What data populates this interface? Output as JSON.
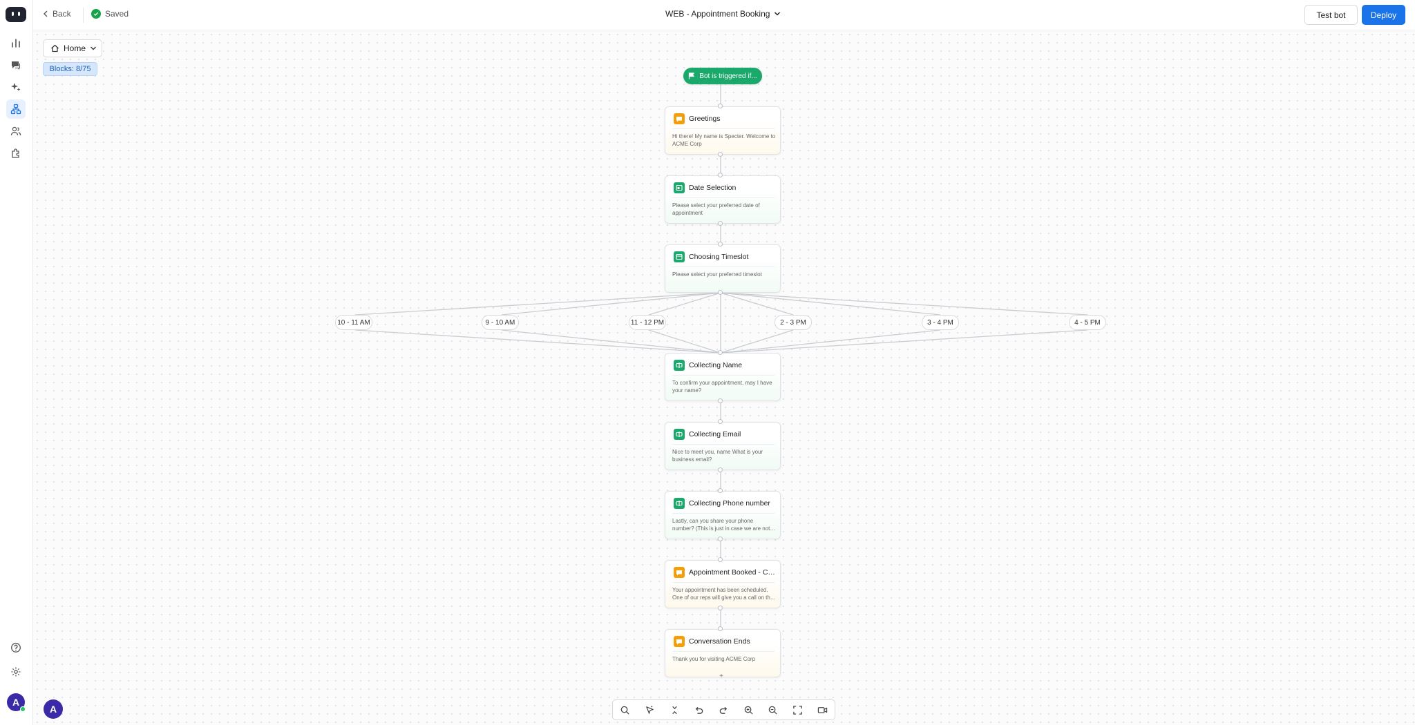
{
  "topbar": {
    "back_label": "Back",
    "saved_label": "Saved",
    "bot_title": "WEB - Appointment Booking",
    "test_bot_label": "Test bot",
    "deploy_label": "Deploy"
  },
  "sidebar": {
    "items": [
      {
        "name": "analytics",
        "icon": "bar-chart-icon"
      },
      {
        "name": "conversations",
        "icon": "chat-icon"
      },
      {
        "name": "ai",
        "icon": "sparkles-icon"
      },
      {
        "name": "builder",
        "icon": "flow-icon",
        "active": true
      },
      {
        "name": "contacts",
        "icon": "users-icon"
      },
      {
        "name": "integrations",
        "icon": "puzzle-icon"
      }
    ],
    "bottom_items": [
      {
        "name": "help",
        "icon": "help-icon"
      },
      {
        "name": "settings",
        "icon": "gear-icon"
      }
    ],
    "avatar_letter": "A"
  },
  "canvas": {
    "home_label": "Home",
    "blocks_label": "Blocks: 8/75",
    "trigger_label": "Bot is triggered if...",
    "workspace_avatar": "A",
    "nodes": [
      {
        "title": "Greetings",
        "text": "Hi there! My name is Specter. Welcome to ACME Corp",
        "kind": "message"
      },
      {
        "title": "Date Selection",
        "text": "Please select your preferred date of appointment",
        "kind": "question"
      },
      {
        "title": "Choosing Timeslot",
        "text": "Please select your preferred timeslot",
        "kind": "question"
      },
      {
        "title": "Collecting Name",
        "text": "To confirm your appointment, may I have your name?",
        "kind": "question"
      },
      {
        "title": "Collecting Email",
        "text": "Nice to meet you, name What is your business email?",
        "kind": "question"
      },
      {
        "title": "Collecting Phone number",
        "text": "Lastly, can you share your phone number? (This is just in case we are not able to...",
        "kind": "question"
      },
      {
        "title": "Appointment Booked - Co...",
        "text": "Your appointment has been scheduled. One of our reps will give you a call on the date...",
        "kind": "message"
      },
      {
        "title": "Conversation Ends",
        "text": "Thank you for visiting ACME Corp",
        "kind": "message"
      }
    ],
    "timeslots": [
      "10 - 11 AM",
      "9 - 10 AM",
      "11 - 12 PM",
      "2 - 3 PM",
      "3 - 4 PM",
      "4 - 5 PM"
    ]
  },
  "toolbar": {
    "tools": [
      "search-icon",
      "auto-arrange-icon",
      "collapse-icon",
      "undo-icon",
      "redo-icon",
      "zoom-in-icon",
      "zoom-out-icon",
      "fullscreen-icon",
      "video-icon"
    ]
  },
  "colors": {
    "accent": "#1a73e8",
    "trigger": "#1aa86b",
    "message_icon": "#f59e0b",
    "question_icon": "#1aa86b"
  }
}
